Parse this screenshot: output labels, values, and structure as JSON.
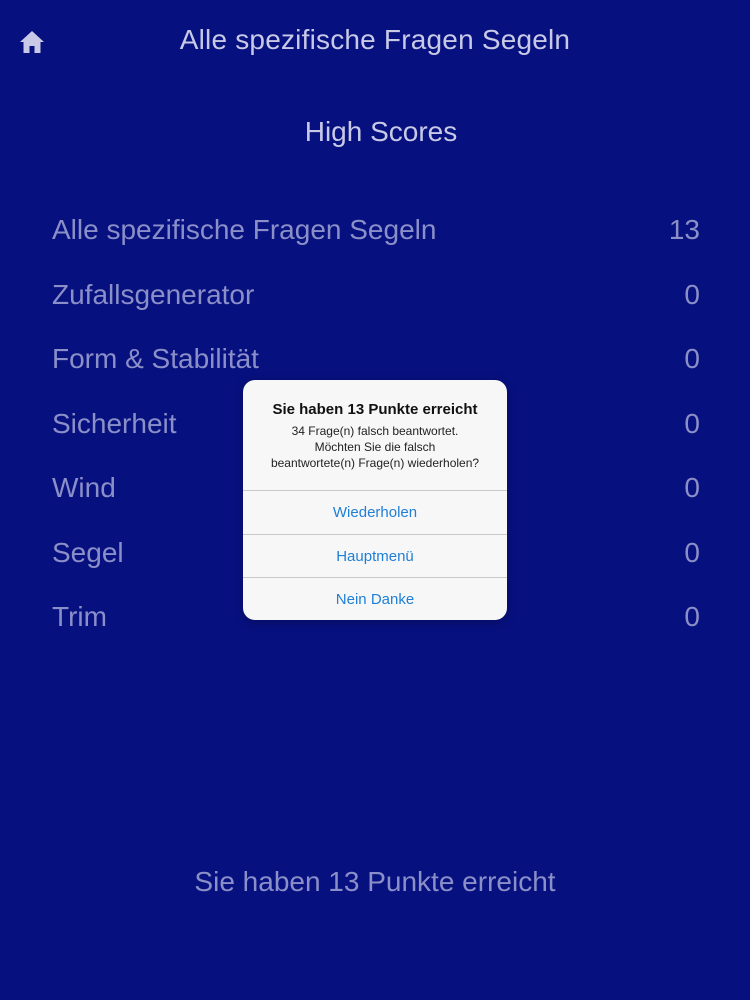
{
  "app": {
    "nav_title": "Alle spezifische Fragen Segeln",
    "section_title": "High Scores",
    "icons": {
      "home": "home-icon"
    }
  },
  "scores": [
    {
      "name": "Alle spezifische Fragen Segeln",
      "value": "13"
    },
    {
      "name": "Zufallsgenerator",
      "value": "0"
    },
    {
      "name": "Form & Stabilität",
      "value": "0"
    },
    {
      "name": "Sicherheit",
      "value": "0"
    },
    {
      "name": "Wind",
      "value": "0"
    },
    {
      "name": "Segel",
      "value": "0"
    },
    {
      "name": "Trim",
      "value": "0"
    }
  ],
  "footer": {
    "text": "Sie haben 13 Punkte erreicht"
  },
  "alert": {
    "title": "Sie haben 13 Punkte erreicht",
    "message": "34 Frage(n) falsch beantwortet.\nMöchten Sie die falsch\nbeantwortete(n) Frage(n) wiederholen?",
    "buttons": [
      "Wiederholen",
      "Hauptmenü",
      "Nein Danke"
    ]
  },
  "colors": {
    "background": "#07107f",
    "text_primary": "#c7c9e6",
    "text_dimmed": "#8b8fc8",
    "alert_button": "#1f7fd6"
  }
}
